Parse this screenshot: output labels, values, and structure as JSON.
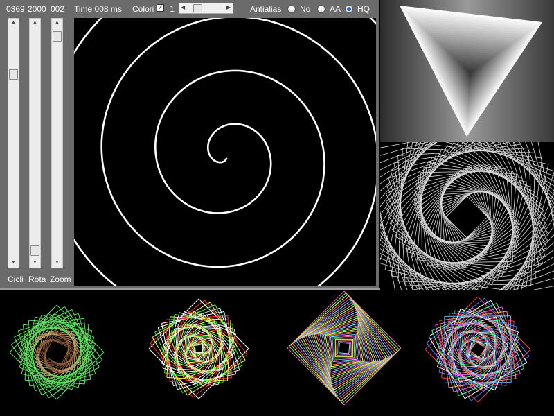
{
  "header": {
    "cicli_value": "0369",
    "rota_value": "2000",
    "zoom_value": "002",
    "time_label": "Time 008 ms",
    "colori_label": "Colori",
    "colori_checked": true,
    "colori_count": "1",
    "antialias_label": "Antialias",
    "antialias_options": [
      "No",
      "AA",
      "HQ"
    ],
    "antialias_selected": "HQ"
  },
  "sliders": {
    "cicli_label": "Cicli",
    "rota_label": "Rota",
    "zoom_label": "Zoom"
  },
  "colors": {
    "panel_bg": "#6b6b6b",
    "canvas_bg": "#000000",
    "stroke": "#ffffff",
    "accent": "#2a64b8"
  }
}
